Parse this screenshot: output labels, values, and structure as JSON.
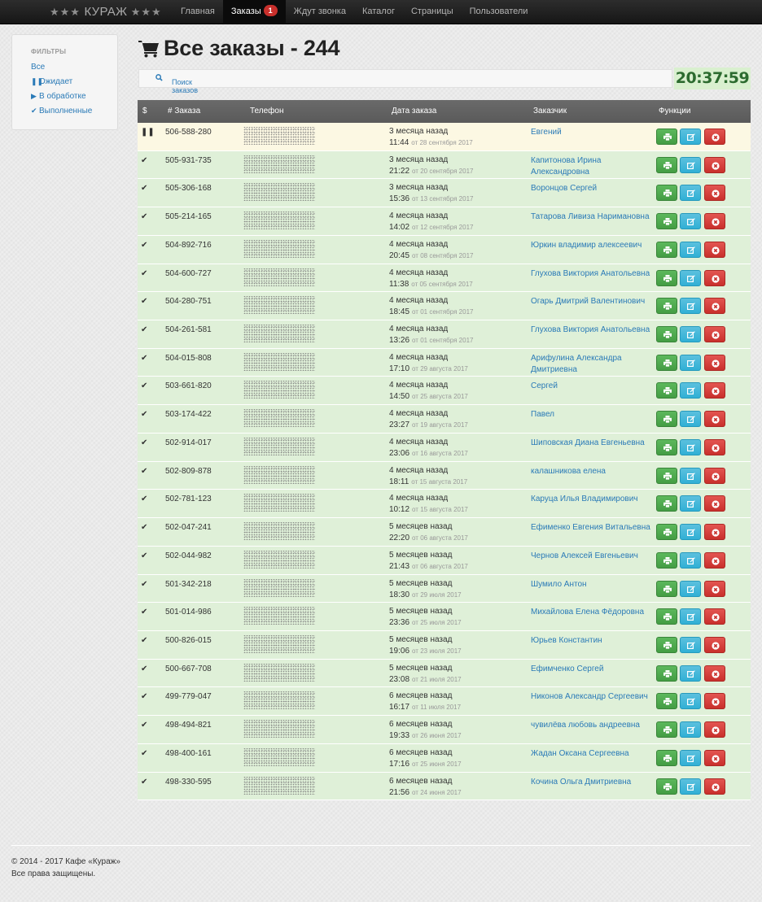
{
  "navbar": {
    "brand": "КУРАЖ",
    "brand_stars_left": "★★★",
    "brand_stars_right": "★★★",
    "items": [
      {
        "label": "Главная",
        "active": false
      },
      {
        "label": "Заказы",
        "active": true,
        "badge": "1"
      },
      {
        "label": "Ждут звонка",
        "active": false
      },
      {
        "label": "Каталог",
        "active": false
      },
      {
        "label": "Страницы",
        "active": false
      },
      {
        "label": "Пользователи",
        "active": false
      }
    ]
  },
  "filters": {
    "heading": "ФИЛЬТРЫ",
    "items": [
      {
        "label": "Все",
        "icon": ""
      },
      {
        "label": "Ожидает",
        "icon": "pause-icon"
      },
      {
        "label": "В обработке",
        "icon": "play-icon"
      },
      {
        "label": "Выполненные",
        "icon": "check-icon"
      }
    ]
  },
  "page": {
    "title": "Все заказы - 244",
    "search_label": "Поиск заказов",
    "clock": "20:37:59"
  },
  "table": {
    "headers": [
      "$",
      "# Заказа",
      "Телефон",
      "Дата заказа",
      "Заказчик",
      "Функции"
    ],
    "rows": [
      {
        "status": "wait",
        "num": "506-588-280",
        "rel": "3 месяца назад",
        "time": "11:44",
        "date": "от 28 сентября 2017",
        "customer": "Евгений"
      },
      {
        "status": "done",
        "num": "505-931-735",
        "rel": "3 месяца назад",
        "time": "21:22",
        "date": "от 20 сентября 2017",
        "customer": "Капитонова Ирина Александровна"
      },
      {
        "status": "done",
        "num": "505-306-168",
        "rel": "3 месяца назад",
        "time": "15:36",
        "date": "от 13 сентября 2017",
        "customer": "Воронцов Сергей"
      },
      {
        "status": "done",
        "num": "505-214-165",
        "rel": "4 месяца назад",
        "time": "14:02",
        "date": "от 12 сентября 2017",
        "customer": "Татарова Ливиза Наримановна"
      },
      {
        "status": "done",
        "num": "504-892-716",
        "rel": "4 месяца назад",
        "time": "20:45",
        "date": "от 08 сентября 2017",
        "customer": "Юркин владимир алексеевич"
      },
      {
        "status": "done",
        "num": "504-600-727",
        "rel": "4 месяца назад",
        "time": "11:38",
        "date": "от 05 сентября 2017",
        "customer": "Глухова Виктория Анатольевна"
      },
      {
        "status": "done",
        "num": "504-280-751",
        "rel": "4 месяца назад",
        "time": "18:45",
        "date": "от 01 сентября 2017",
        "customer": "Огарь Дмитрий Валентинович"
      },
      {
        "status": "done",
        "num": "504-261-581",
        "rel": "4 месяца назад",
        "time": "13:26",
        "date": "от 01 сентября 2017",
        "customer": "Глухова Виктория Анатольевна"
      },
      {
        "status": "done",
        "num": "504-015-808",
        "rel": "4 месяца назад",
        "time": "17:10",
        "date": "от 29 августа 2017",
        "customer": "Арифулина Александра Дмитриевна"
      },
      {
        "status": "done",
        "num": "503-661-820",
        "rel": "4 месяца назад",
        "time": "14:50",
        "date": "от 25 августа 2017",
        "customer": "Сергей"
      },
      {
        "status": "done",
        "num": "503-174-422",
        "rel": "4 месяца назад",
        "time": "23:27",
        "date": "от 19 августа 2017",
        "customer": "Павел"
      },
      {
        "status": "done",
        "num": "502-914-017",
        "rel": "4 месяца назад",
        "time": "23:06",
        "date": "от 16 августа 2017",
        "customer": "Шиповская Диана Евгеньевна"
      },
      {
        "status": "done",
        "num": "502-809-878",
        "rel": "4 месяца назад",
        "time": "18:11",
        "date": "от 15 августа 2017",
        "customer": "калашникова елена"
      },
      {
        "status": "done",
        "num": "502-781-123",
        "rel": "4 месяца назад",
        "time": "10:12",
        "date": "от 15 августа 2017",
        "customer": "Каруца Илья Владимирович"
      },
      {
        "status": "done",
        "num": "502-047-241",
        "rel": "5 месяцев назад",
        "time": "22:20",
        "date": "от 06 августа 2017",
        "customer": "Ефименко Евгения Витальевна"
      },
      {
        "status": "done",
        "num": "502-044-982",
        "rel": "5 месяцев назад",
        "time": "21:43",
        "date": "от 06 августа 2017",
        "customer": "Чернов Алексей Евгеньевич"
      },
      {
        "status": "done",
        "num": "501-342-218",
        "rel": "5 месяцев назад",
        "time": "18:30",
        "date": "от 29 июля 2017",
        "customer": "Шумило Антон"
      },
      {
        "status": "done",
        "num": "501-014-986",
        "rel": "5 месяцев назад",
        "time": "23:36",
        "date": "от 25 июля 2017",
        "customer": "Михайлова Елена Фёдоровна"
      },
      {
        "status": "done",
        "num": "500-826-015",
        "rel": "5 месяцев назад",
        "time": "19:06",
        "date": "от 23 июля 2017",
        "customer": "Юрьев Константин"
      },
      {
        "status": "done",
        "num": "500-667-708",
        "rel": "5 месяцев назад",
        "time": "23:08",
        "date": "от 21 июля 2017",
        "customer": "Ефимченко Сергей"
      },
      {
        "status": "done",
        "num": "499-779-047",
        "rel": "6 месяцев назад",
        "time": "16:17",
        "date": "от 11 июля 2017",
        "customer": "Никонов Александр Сергеевич"
      },
      {
        "status": "done",
        "num": "498-494-821",
        "rel": "6 месяцев назад",
        "time": "19:33",
        "date": "от 26 июня 2017",
        "customer": "чувилёва любовь андреевна"
      },
      {
        "status": "done",
        "num": "498-400-161",
        "rel": "6 месяцев назад",
        "time": "17:16",
        "date": "от 25 июня 2017",
        "customer": "Жадан Оксана Сергеевна"
      },
      {
        "status": "done",
        "num": "498-330-595",
        "rel": "6 месяцев назад",
        "time": "21:56",
        "date": "от 24 июня 2017",
        "customer": "Кочина Ольга Дмитриевна"
      }
    ]
  },
  "footer": {
    "copyright": "© 2014 - 2017 Кафе «Кураж»",
    "rights": "Все права защищены."
  }
}
